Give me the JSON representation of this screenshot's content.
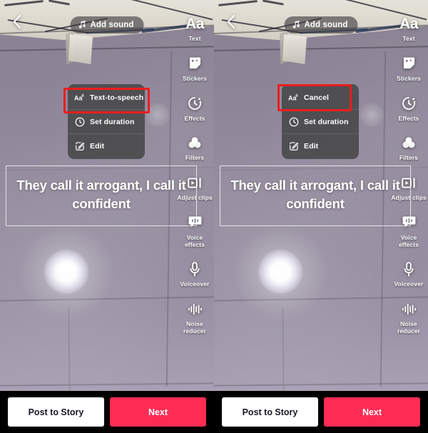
{
  "colors": {
    "accent_red": "#FE2C55",
    "annotation_red": "#EF1D1D",
    "menu_background": "#4A4A4C",
    "button_white": "#FFFFFF",
    "bottom_bar": "#000000",
    "wall": "#8F8799"
  },
  "panels": [
    {
      "id": "left",
      "topbar": {
        "back_icon": "chevron-left-icon",
        "add_sound_label": "Add sound",
        "add_sound_icon": "music-note-icon"
      },
      "rail": [
        {
          "label": "Text",
          "icon": "text-aa-icon"
        },
        {
          "label": "Stickers",
          "icon": "sticker-icon"
        },
        {
          "label": "Effects",
          "icon": "effects-clock-icon"
        },
        {
          "label": "Filters",
          "icon": "filters-circles-icon"
        },
        {
          "label": "Adjust clips",
          "icon": "adjust-clips-icon"
        },
        {
          "label": "Voice effects",
          "icon": "voice-effects-icon"
        },
        {
          "label": "Voiceover",
          "icon": "microphone-icon"
        },
        {
          "label": "Noise reducer",
          "icon": "noise-reducer-icon"
        }
      ],
      "context_menu": {
        "highlighted_index": 0,
        "items": [
          {
            "label": "Text-to-speech",
            "icon": "text-to-speech-icon"
          },
          {
            "label": "Set duration",
            "icon": "clock-icon"
          },
          {
            "label": "Edit",
            "icon": "pencil-edit-icon"
          }
        ]
      },
      "caption": {
        "text": "They call it arrogant, I call it confident"
      },
      "bottom": {
        "post_to_story_label": "Post to Story",
        "next_label": "Next"
      }
    },
    {
      "id": "right",
      "topbar": {
        "back_icon": "chevron-left-icon",
        "add_sound_label": "Add sound",
        "add_sound_icon": "music-note-icon"
      },
      "rail": [
        {
          "label": "Text",
          "icon": "text-aa-icon"
        },
        {
          "label": "Stickers",
          "icon": "sticker-icon"
        },
        {
          "label": "Effects",
          "icon": "effects-clock-icon"
        },
        {
          "label": "Filters",
          "icon": "filters-circles-icon"
        },
        {
          "label": "Adjust clips",
          "icon": "adjust-clips-icon"
        },
        {
          "label": "Voice effects",
          "icon": "voice-effects-icon"
        },
        {
          "label": "Voiceover",
          "icon": "microphone-icon"
        },
        {
          "label": "Noise reducer",
          "icon": "noise-reducer-icon"
        }
      ],
      "context_menu": {
        "highlighted_index": 0,
        "items": [
          {
            "label": "Cancel",
            "icon": "text-to-speech-icon"
          },
          {
            "label": "Set duration",
            "icon": "clock-icon"
          },
          {
            "label": "Edit",
            "icon": "pencil-edit-icon"
          }
        ]
      },
      "caption": {
        "text": "They call it arrogant, I call it confident"
      },
      "bottom": {
        "post_to_story_label": "Post to Story",
        "next_label": "Next"
      }
    }
  ]
}
